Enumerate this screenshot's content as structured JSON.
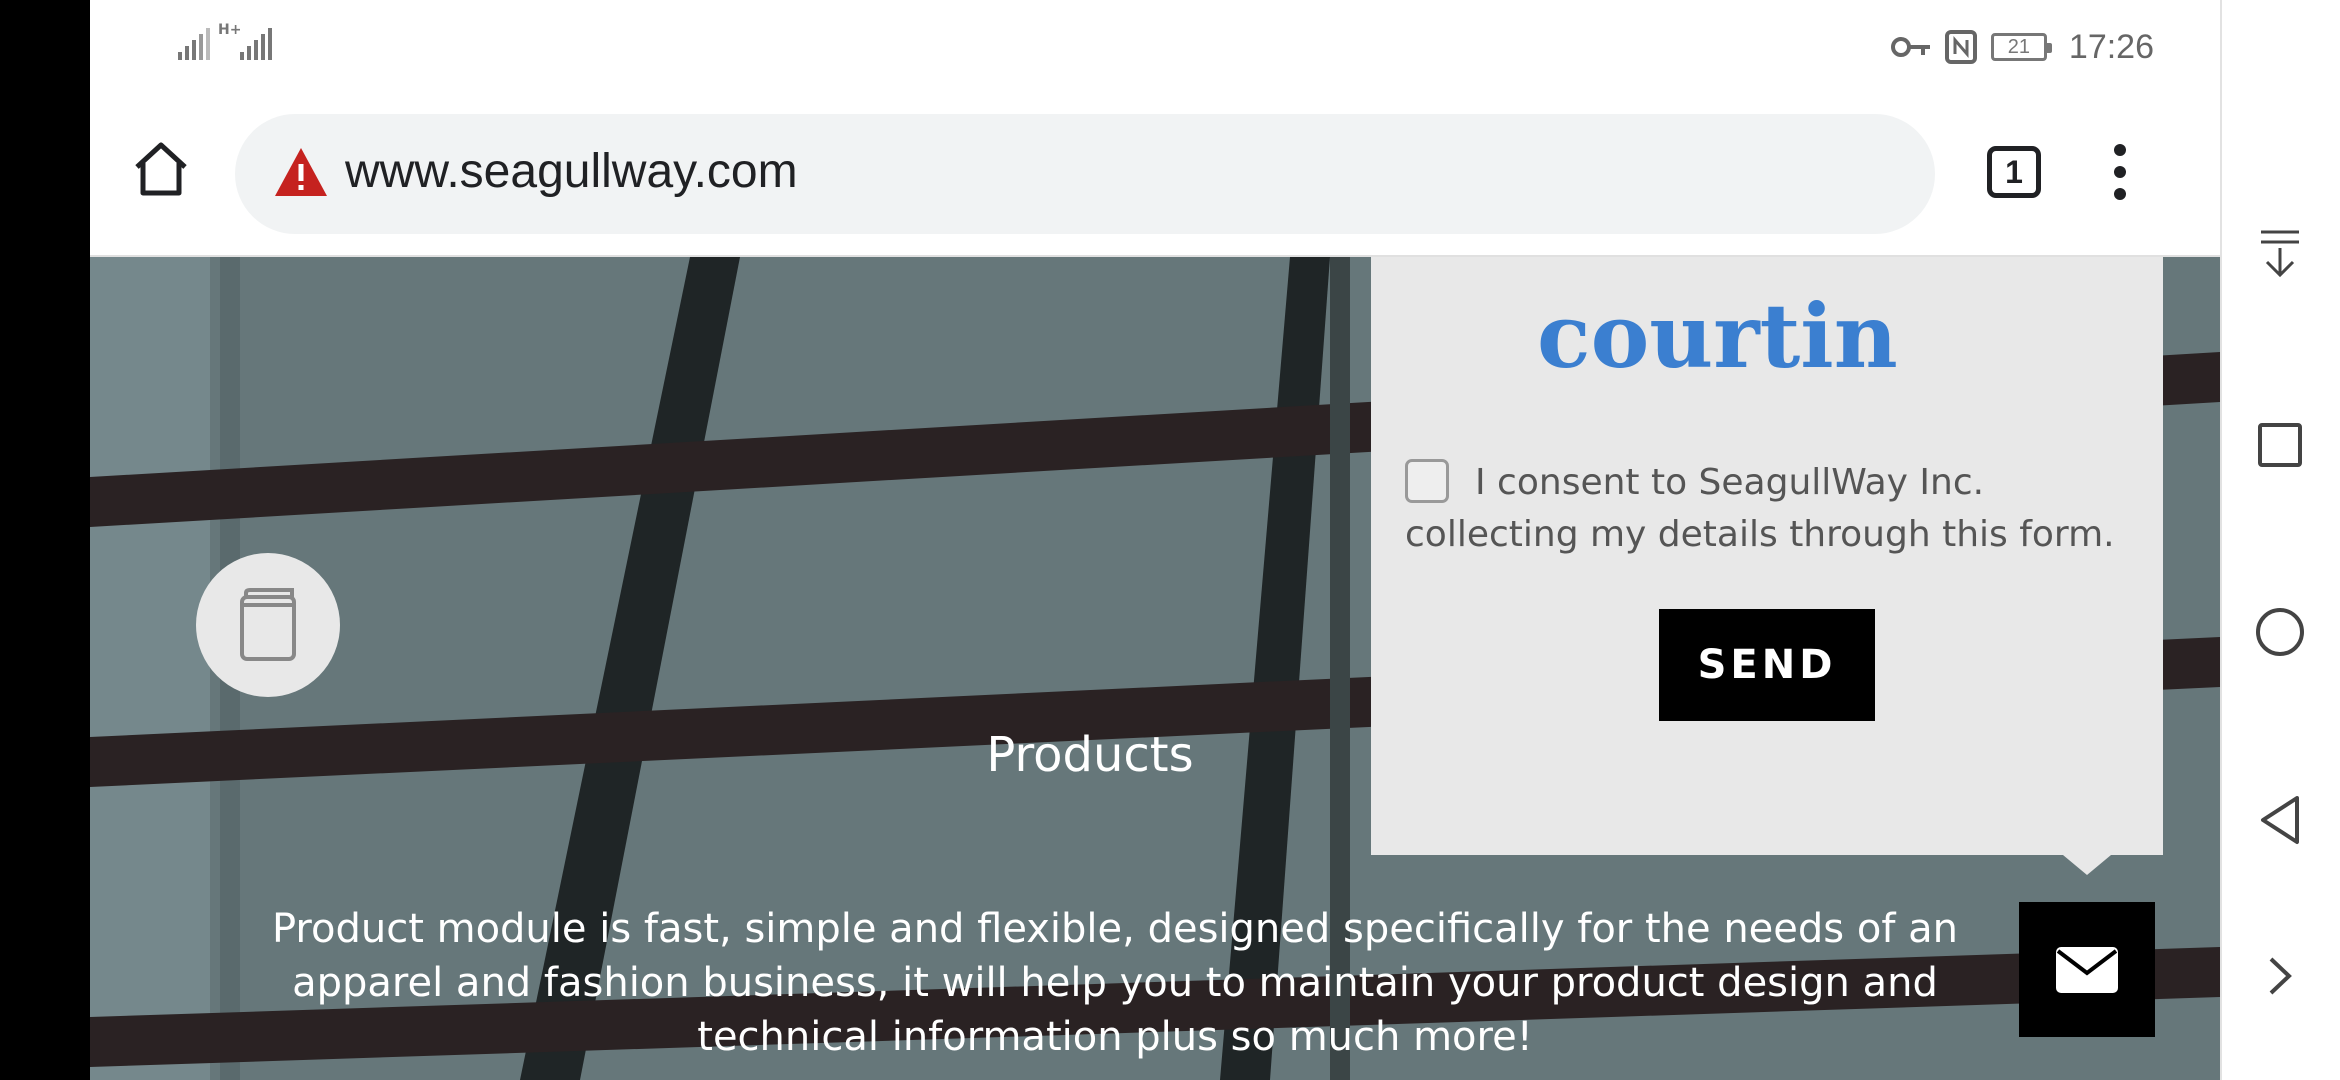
{
  "status_bar": {
    "network_type": "H+",
    "battery_level": "21",
    "time": "17:26"
  },
  "browser": {
    "url": "www.seagullway.com",
    "tab_count": "1"
  },
  "popup": {
    "captcha_text": "courtin",
    "consent_text": "I consent to SeagullWay Inc. collecting my details through this form.",
    "send_label": "SEND"
  },
  "hero": {
    "section_title": "Products",
    "description": "Product module is fast, simple and flexible, designed specifically for the needs of an apparel and fashion business, it will help you to maintain your product design and technical information plus so much more!"
  },
  "icons": {
    "home": "home-icon",
    "warning": "warning-icon",
    "tabs": "tabs-icon",
    "menu": "more-vert-icon",
    "book": "book-icon",
    "mail": "mail-icon",
    "nav_down": "scroll-down-icon",
    "nav_recents": "square-icon",
    "nav_home": "circle-icon",
    "nav_back": "back-triangle-icon",
    "nav_forward": "chevron-right-icon"
  },
  "colors": {
    "warning_red": "#c5221f",
    "url_bar_bg": "#f1f3f4",
    "popup_bg": "#e8e8e8",
    "captcha_blue": "#3b7fd0"
  }
}
